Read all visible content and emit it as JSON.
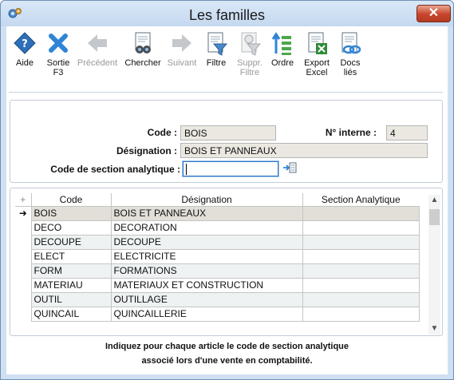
{
  "window": {
    "title": "Les familles",
    "close_symbol": "✕"
  },
  "toolbar": {
    "aide": "Aide",
    "sortie_1": "Sortie",
    "sortie_2": "F3",
    "precedent": "Précédent",
    "chercher": "Chercher",
    "suivant": "Suivant",
    "filtre": "Filtre",
    "suppr_1": "Suppr.",
    "suppr_2": "Filtre",
    "ordre": "Ordre",
    "export_1": "Export",
    "export_2": "Excel",
    "docs_1": "Docs",
    "docs_2": "liés"
  },
  "form": {
    "code_label": "Code :",
    "code_value": "BOIS",
    "num_label": "N° interne :",
    "num_value": "4",
    "designation_label": "Désignation :",
    "designation_value": "BOIS ET PANNEAUX",
    "section_label": "Code de section analytique :",
    "section_value": ""
  },
  "grid": {
    "columns": [
      "Code",
      "Désignation",
      "Section Analytique"
    ],
    "add_symbol": "+",
    "selected_marker": "➜",
    "rows": [
      {
        "code": "BOIS",
        "designation": "BOIS ET PANNEAUX",
        "section": ""
      },
      {
        "code": "DECO",
        "designation": "DECORATION",
        "section": ""
      },
      {
        "code": "DECOUPE",
        "designation": "DECOUPE",
        "section": ""
      },
      {
        "code": "ELECT",
        "designation": "ELECTRICITE",
        "section": ""
      },
      {
        "code": "FORM",
        "designation": "FORMATIONS",
        "section": ""
      },
      {
        "code": "MATERIAU",
        "designation": "MATERIAUX ET CONSTRUCTION",
        "section": ""
      },
      {
        "code": "OUTIL",
        "designation": "OUTILLAGE",
        "section": ""
      },
      {
        "code": "QUINCAIL",
        "designation": "QUINCAILLERIE",
        "section": ""
      }
    ]
  },
  "hint": {
    "line1": "Indiquez pour chaque article le code de section analytique",
    "line2": "associé lors d'une vente en comptabilité."
  },
  "colors": {
    "accent": "#2f74c6",
    "disabled": "#9a9a9a"
  }
}
